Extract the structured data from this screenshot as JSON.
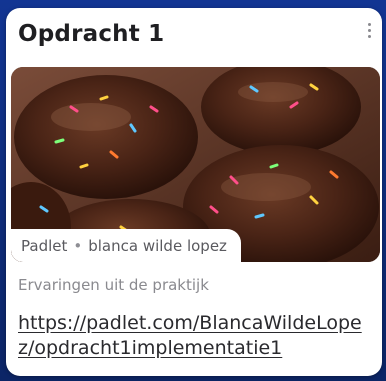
{
  "card": {
    "title": "Opdracht 1",
    "attachment": {
      "image_alt": "chocolate cupcakes with sprinkles",
      "source": "Padlet",
      "separator": "•",
      "author": "blanca wilde lopez"
    },
    "subtitle": "Ervaringen uit de praktijk",
    "link_text": "https://padlet.com/BlancaWildeLopez/opdracht1implementatie1",
    "menu_icon": "more-vertical-icon"
  },
  "colors": {
    "background": "#123593",
    "card": "#ffffff",
    "title": "#1f1f22",
    "muted": "#8a8a8f"
  }
}
